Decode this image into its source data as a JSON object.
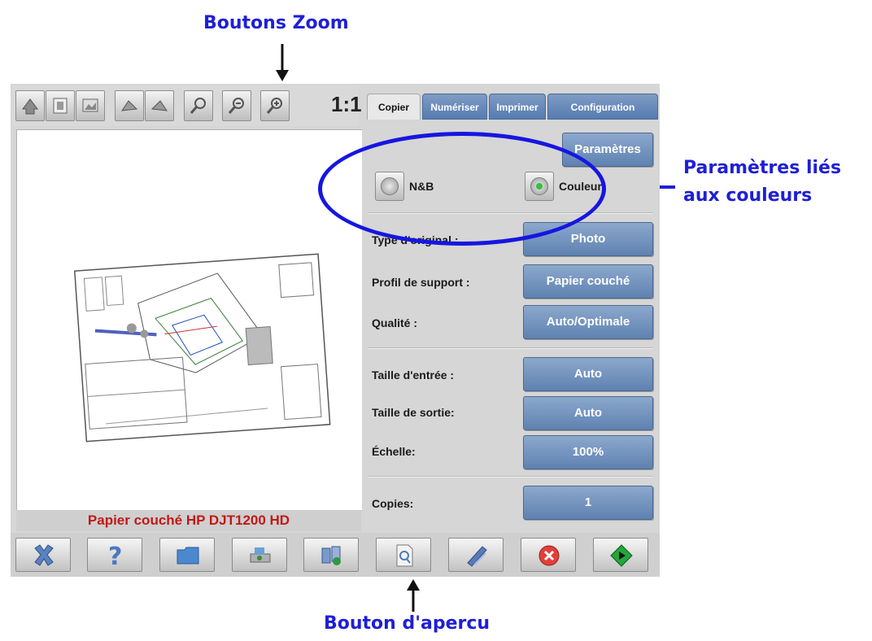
{
  "annotations": {
    "zoom": "Boutons Zoom",
    "color_line1": "Paramètres liés",
    "color_line2": "aux couleurs",
    "preview": "Bouton d'apercu"
  },
  "zoom_toolbar": {
    "icons": [
      "rotate-left-icon",
      "fit-page-icon",
      "image-icon",
      "rotate-ccw-icon",
      "rotate-cw-icon",
      "zoom-region-icon",
      "zoom-out-icon",
      "zoom-in-icon"
    ],
    "one_to_one": "1:1"
  },
  "preview": {
    "caption": "Papier couché HP DJT1200 HD"
  },
  "tabs": [
    {
      "label": "Copier",
      "active": true
    },
    {
      "label": "Numériser",
      "active": false
    },
    {
      "label": "Imprimer",
      "active": false
    },
    {
      "label": "Configuration",
      "active": false
    }
  ],
  "panel": {
    "parametres_button": "Paramètres",
    "color_mode": {
      "bw_label": "N&B",
      "color_label": "Couleur",
      "selected": "Couleur"
    },
    "settings": [
      {
        "label": "Type d'original :",
        "value": "Photo"
      },
      {
        "label": "Profil de support :",
        "value": "Papier couché"
      },
      {
        "label": "Qualité :",
        "value": "Auto/Optimale"
      },
      {
        "label": "Taille d'entrée :",
        "value": "Auto"
      },
      {
        "label": "Taille de sortie:",
        "value": "Auto"
      },
      {
        "label": "Échelle:",
        "value": "100%"
      },
      {
        "label": "Copies:",
        "value": "1"
      }
    ]
  },
  "bottom_toolbar": {
    "icons": [
      "cancel-x-icon",
      "help-icon",
      "folder-icon",
      "scanner-icon",
      "transfer-icon",
      "preview-icon",
      "clean-icon",
      "stop-icon",
      "start-icon"
    ]
  },
  "colors": {
    "annotation": "#1f1fd6",
    "tab_blue": "#5f82b1",
    "caption_red": "#c21818"
  }
}
